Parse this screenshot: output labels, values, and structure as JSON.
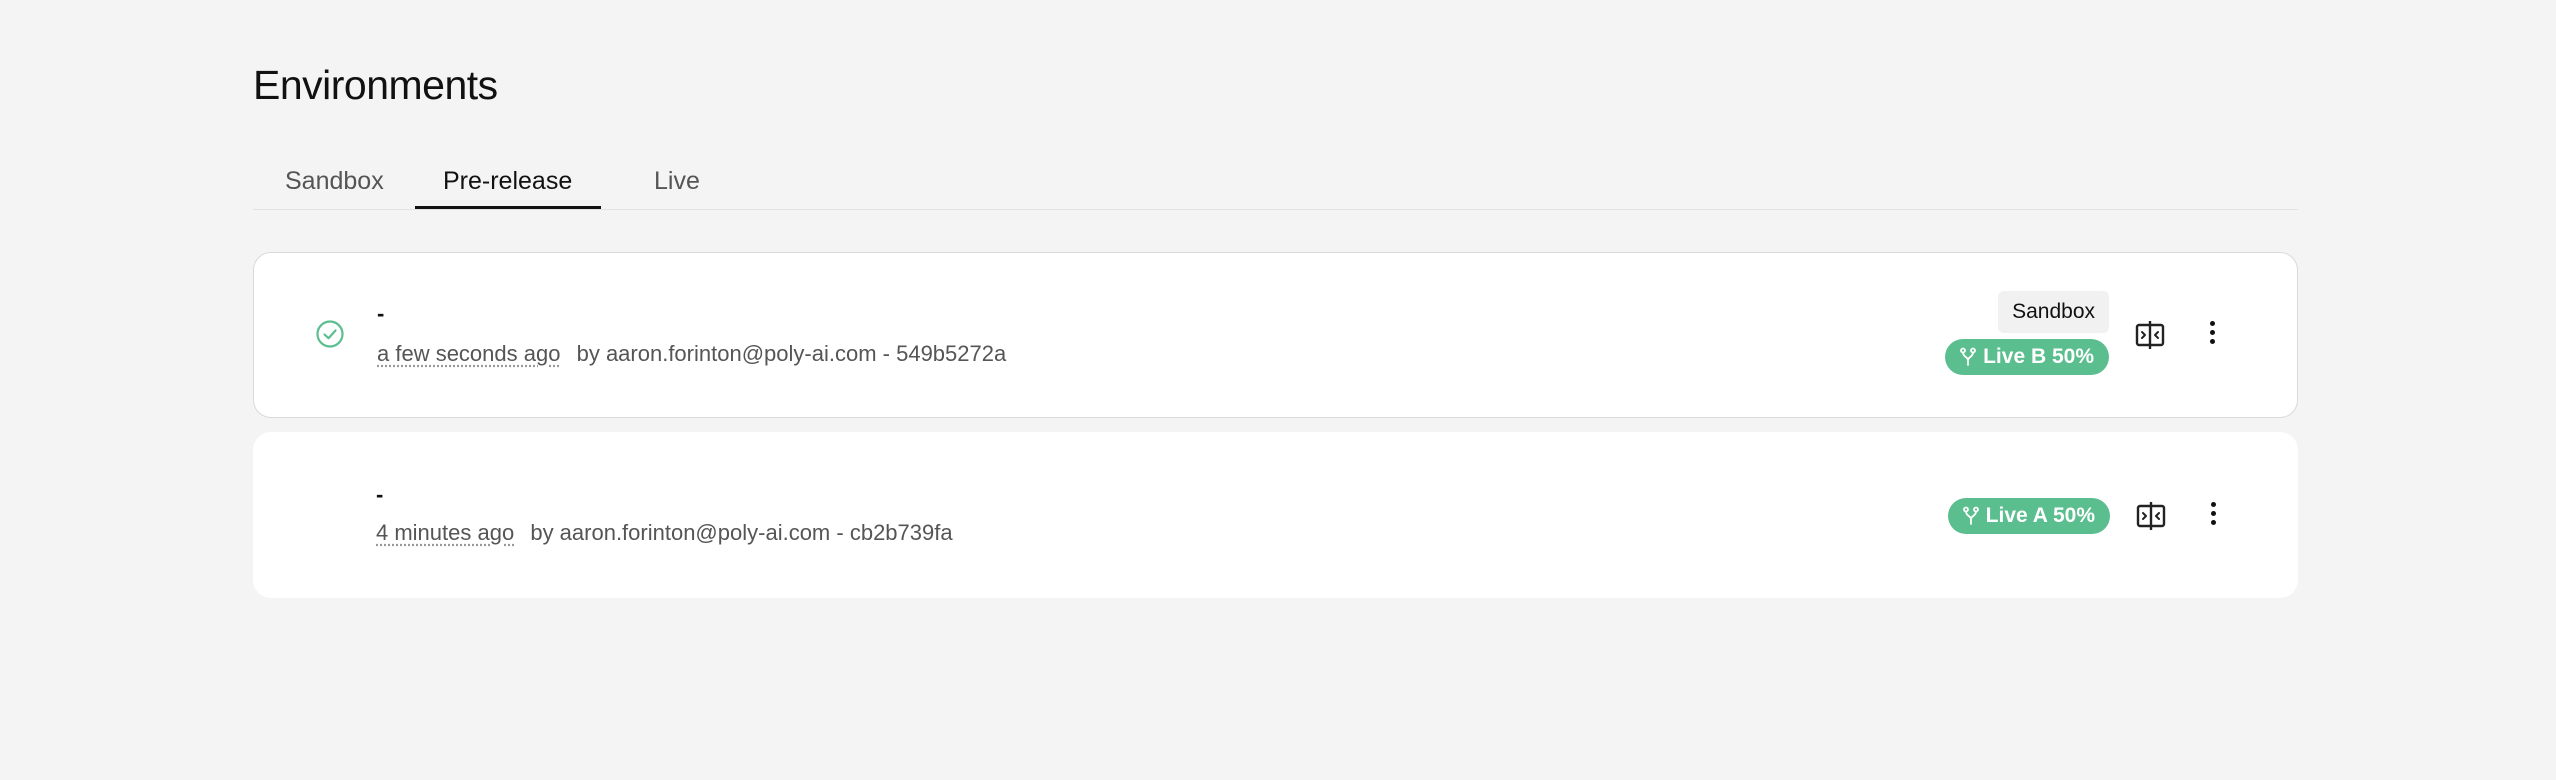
{
  "page": {
    "title": "Environments"
  },
  "tabs": [
    {
      "label": "Sandbox",
      "active": false
    },
    {
      "label": "Pre-release",
      "active": true
    },
    {
      "label": "Live",
      "active": false
    }
  ],
  "deployments": [
    {
      "title": "-",
      "time": "a few seconds ago",
      "author": "by aaron.forinton@poly-ai.com",
      "separator": "-",
      "commit": "549b5272a",
      "status_icon": "check-circle-icon",
      "environment_badge": "Sandbox",
      "live_badge": "Live B 50%",
      "selected": true
    },
    {
      "title": "-",
      "time": "4 minutes ago",
      "author": "by aaron.forinton@poly-ai.com",
      "separator": "-",
      "commit": "cb2b739fa",
      "environment_badge": "",
      "live_badge": "Live A 50%",
      "selected": false
    }
  ],
  "colors": {
    "background": "#f4f4f4",
    "accent_green": "#5bbe8e",
    "text_primary": "#111111",
    "text_secondary": "#555555"
  },
  "icons": {
    "status": "check-circle-icon",
    "branch": "branch-icon",
    "compare": "compare-icon",
    "more": "more-vertical-icon"
  }
}
